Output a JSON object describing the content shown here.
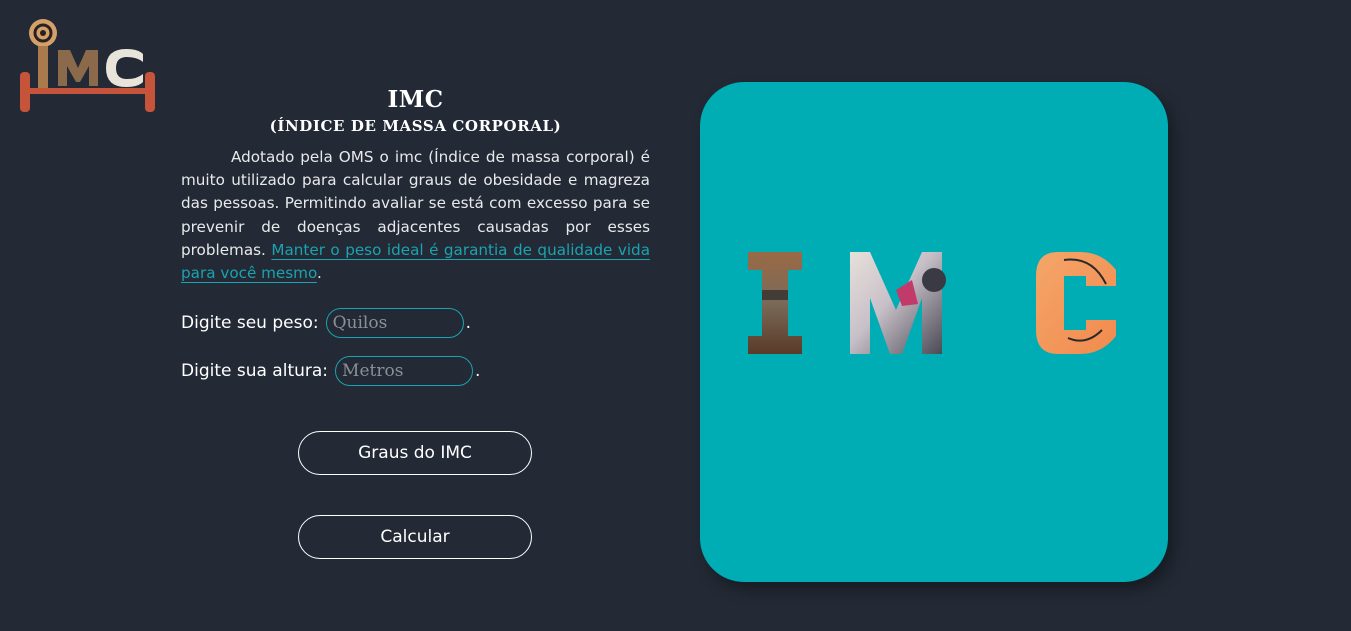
{
  "logo": {
    "text": "IMC"
  },
  "intro": {
    "title": "IMC",
    "subtitle": "(ÍNDICE DE MASSA CORPORAL)",
    "description": "Adotado pela OMS o imc (Índice de massa corporal) é muito utilizado para calcular graus de obesidade e magreza das pessoas. Permitindo avaliar se está com excesso para se prevenir de doenças adjacentes causadas por esses problemas.",
    "highlight": "Manter o peso ideal é garantia de qualidade vida para você mesmo",
    "highlight_end": "."
  },
  "form": {
    "weight_label": "Digite seu peso:",
    "weight_placeholder": "Quilos",
    "weight_value": "",
    "height_label": "Digite sua altura:",
    "height_placeholder": "Metros",
    "height_value": "",
    "dot": "."
  },
  "buttons": {
    "grades_label": "Graus do IMC",
    "calculate_label": "Calcular"
  },
  "card": {
    "art_text": "IMC"
  },
  "colors": {
    "background": "#232a35",
    "accent": "#00adb5",
    "highlight": "#1aa3b0",
    "logo_bar": "#c5543a"
  }
}
